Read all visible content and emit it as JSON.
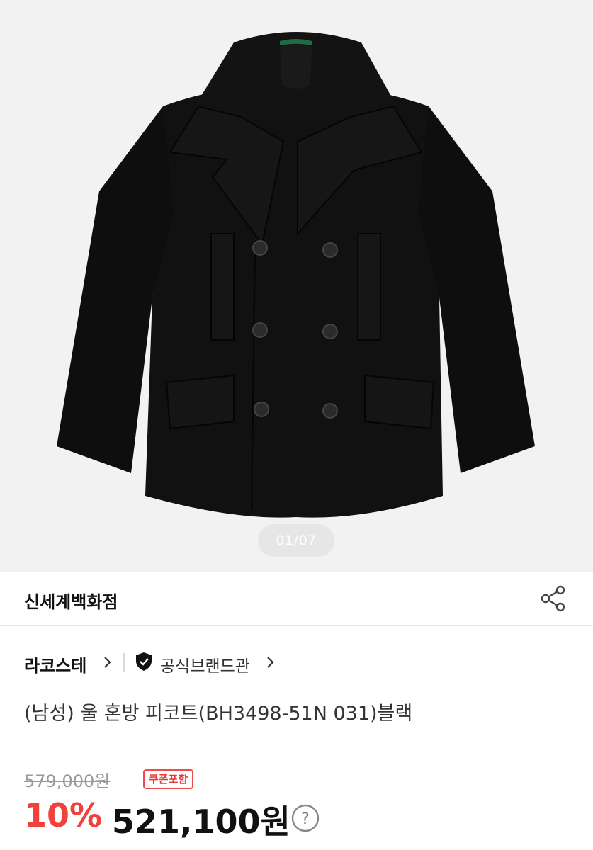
{
  "hero": {
    "image_alt": "black wool double-breasted pea coat",
    "page_indicator": "01/07",
    "colors": {
      "background": "#f2f2f2",
      "coat": "#0f0f0f",
      "collar_lining": "#1f6b45"
    }
  },
  "store": {
    "name": "신세계백화점",
    "share_icon": "share-icon"
  },
  "brand": {
    "name": "라코스테",
    "official_label": "공식브랜드관",
    "icons": [
      "chevron-right-icon",
      "shield-check-icon"
    ]
  },
  "product": {
    "title": "(남성) 울 혼방 피코트(BH3498-51N 031)블랙"
  },
  "price": {
    "original": "579,000원",
    "coupon_badge": "쿠폰포함",
    "discount_rate": "10%",
    "sale_price": "521,100원",
    "help_icon": "question-circle-icon",
    "colors": {
      "discount": "#f0413c",
      "coupon_border": "#f04a4a"
    }
  }
}
